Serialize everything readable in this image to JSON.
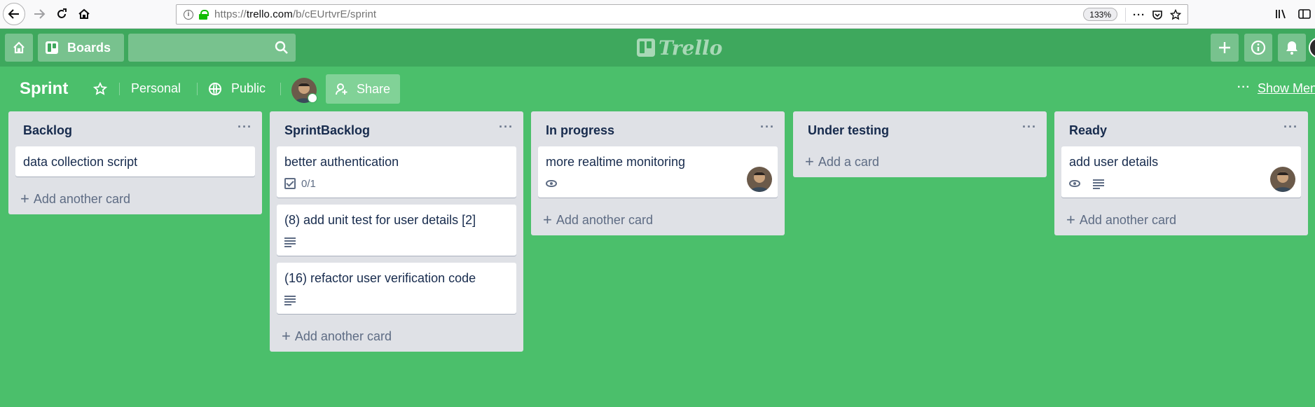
{
  "browser": {
    "url_prefix": "https://",
    "url_domain": "trello.com",
    "url_path": "/b/cEUrtvrE/sprint",
    "zoom": "133%"
  },
  "header": {
    "boards_label": "Boards",
    "logo_text": "Trello"
  },
  "board": {
    "title": "Sprint",
    "team": "Personal",
    "visibility": "Public",
    "share_label": "Share",
    "more_label": "···",
    "show_menu_label": "Show Menu"
  },
  "lists": [
    {
      "title": "Backlog",
      "add_label": "Add another card",
      "cards": [
        {
          "title": "data collection script"
        }
      ]
    },
    {
      "title": "SprintBacklog",
      "add_label": "Add another card",
      "cards": [
        {
          "title": "better authentication",
          "checklist": "0/1"
        },
        {
          "title": "(8) add unit test for user details [2]"
        },
        {
          "title": "(16) refactor user verification code"
        }
      ]
    },
    {
      "title": "In progress",
      "add_label": "Add another card",
      "cards": [
        {
          "title": "more realtime monitoring"
        }
      ]
    },
    {
      "title": "Under testing",
      "add_label": "Add a card",
      "cards": []
    },
    {
      "title": "Ready",
      "add_label": "Add another card",
      "cards": [
        {
          "title": "add user details"
        }
      ]
    }
  ]
}
